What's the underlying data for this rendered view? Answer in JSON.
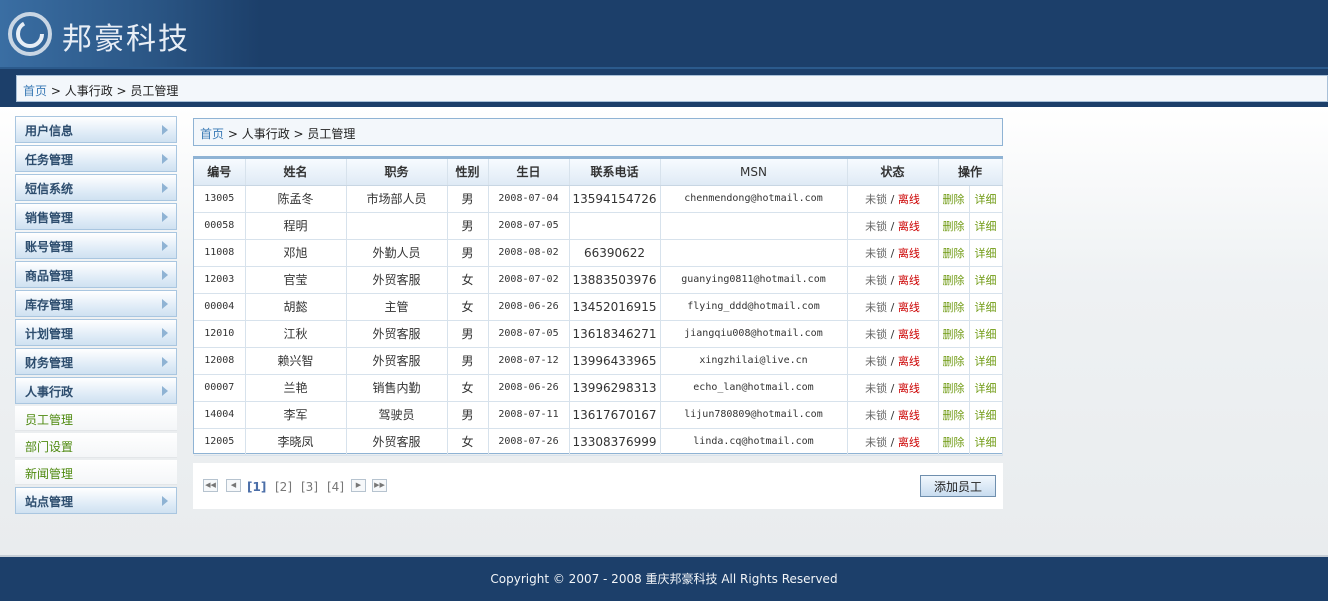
{
  "header": {
    "brand": "邦豪科技"
  },
  "top_breadcrumb": {
    "home": "首页",
    "sep1": "  > ",
    "section": "人事行政",
    "sep2": "  > ",
    "page": "员工管理"
  },
  "sidebar": {
    "items": [
      {
        "label": "用户信息"
      },
      {
        "label": "任务管理"
      },
      {
        "label": "短信系统"
      },
      {
        "label": "销售管理"
      },
      {
        "label": "账号管理"
      },
      {
        "label": "商品管理"
      },
      {
        "label": "库存管理"
      },
      {
        "label": "计划管理"
      },
      {
        "label": "财务管理"
      },
      {
        "label": "人事行政"
      }
    ],
    "sub_items": [
      {
        "label": "员工管理"
      },
      {
        "label": "部门设置"
      },
      {
        "label": "新闻管理"
      }
    ],
    "last_item": {
      "label": "站点管理"
    }
  },
  "main_breadcrumb": {
    "home": "首页",
    "sep1": "  > ",
    "section": "人事行政",
    "sep2": "  > ",
    "page": "员工管理"
  },
  "table": {
    "headers": [
      "编号",
      "姓名",
      "职务",
      "性别",
      "生日",
      "联系电话",
      "MSN",
      "状态",
      "操作"
    ],
    "rows": [
      {
        "id": "13005",
        "name": "陈孟冬",
        "title": "市场部人员",
        "gender": "男",
        "birthday": "2008-07-04",
        "phone": "13594154726",
        "msn": "chenmendong@hotmail.com",
        "lock": "未锁",
        "sep": "/",
        "status": "离线",
        "del": "删除",
        "detail": "详细"
      },
      {
        "id": "00058",
        "name": "程明",
        "title": "",
        "gender": "男",
        "birthday": "2008-07-05",
        "phone": "",
        "msn": "",
        "lock": "未锁",
        "sep": "/",
        "status": "离线",
        "del": "删除",
        "detail": "详细"
      },
      {
        "id": "11008",
        "name": "邓旭",
        "title": "外勤人员",
        "gender": "男",
        "birthday": "2008-08-02",
        "phone": "66390622",
        "msn": "",
        "lock": "未锁",
        "sep": "/",
        "status": "离线",
        "del": "删除",
        "detail": "详细"
      },
      {
        "id": "12003",
        "name": "官莹",
        "title": "外贸客服",
        "gender": "女",
        "birthday": "2008-07-02",
        "phone": "13883503976",
        "msn": "guanying0811@hotmail.com",
        "lock": "未锁",
        "sep": "/",
        "status": "离线",
        "del": "删除",
        "detail": "详细"
      },
      {
        "id": "00004",
        "name": "胡懿",
        "title": "主管",
        "gender": "女",
        "birthday": "2008-06-26",
        "phone": "13452016915",
        "msn": "flying_ddd@hotmail.com",
        "lock": "未锁",
        "sep": "/",
        "status": "离线",
        "del": "删除",
        "detail": "详细"
      },
      {
        "id": "12010",
        "name": "江秋",
        "title": "外贸客服",
        "gender": "男",
        "birthday": "2008-07-05",
        "phone": "13618346271",
        "msn": "jiangqiu008@hotmail.com",
        "lock": "未锁",
        "sep": "/",
        "status": "离线",
        "del": "删除",
        "detail": "详细"
      },
      {
        "id": "12008",
        "name": "赖兴智",
        "title": "外贸客服",
        "gender": "男",
        "birthday": "2008-07-12",
        "phone": "13996433965",
        "msn": "xingzhilai@live.cn",
        "lock": "未锁",
        "sep": "/",
        "status": "离线",
        "del": "删除",
        "detail": "详细"
      },
      {
        "id": "00007",
        "name": "兰艳",
        "title": "销售内勤",
        "gender": "女",
        "birthday": "2008-06-26",
        "phone": "13996298313",
        "msn": "echo_lan@hotmail.com",
        "lock": "未锁",
        "sep": "/",
        "status": "离线",
        "del": "删除",
        "detail": "详细"
      },
      {
        "id": "14004",
        "name": "李军",
        "title": "驾驶员",
        "gender": "男",
        "birthday": "2008-07-11",
        "phone": "13617670167",
        "msn": "lijun780809@hotmail.com",
        "lock": "未锁",
        "sep": "/",
        "status": "离线",
        "del": "删除",
        "detail": "详细"
      },
      {
        "id": "12005",
        "name": "李晓凤",
        "title": "外贸客服",
        "gender": "女",
        "birthday": "2008-07-26",
        "phone": "13308376999",
        "msn": "linda.cq@hotmail.com",
        "lock": "未锁",
        "sep": "/",
        "status": "离线",
        "del": "删除",
        "detail": "详细"
      }
    ]
  },
  "pager": {
    "first": "◀◀",
    "prev": "◀",
    "pages": [
      "[1]",
      "[2]",
      "[3]",
      "[4]"
    ],
    "next": "▶",
    "last": "▶▶"
  },
  "actions": {
    "add_employee": "添加员工"
  },
  "footer": {
    "copyright": "Copyright © 2007 - 2008 重庆邦豪科技 All Rights Reserved"
  }
}
